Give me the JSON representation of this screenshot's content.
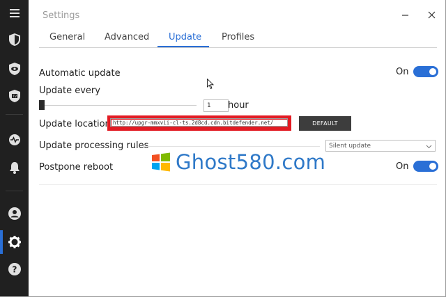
{
  "window": {
    "title": "Settings"
  },
  "tabs": [
    {
      "label": "General"
    },
    {
      "label": "Advanced"
    },
    {
      "label": "Update",
      "active": true
    },
    {
      "label": "Profiles"
    }
  ],
  "sidebar": {
    "icons": [
      "menu-icon",
      "shield-icon",
      "eye-shield-icon",
      "tv-shield-icon",
      "activity-icon",
      "bell-icon",
      "user-icon",
      "gear-icon",
      "help-icon"
    ],
    "active": "gear-icon"
  },
  "settings": {
    "automatic_update": {
      "label": "Automatic update",
      "state_text": "On",
      "on": true
    },
    "update_every": {
      "label": "Update every",
      "value": "1",
      "unit": "hour",
      "slider_level": 0.0
    },
    "update_location": {
      "label": "Update location",
      "url": "http://upgr-mmxvii-cl-ts.2d8cd.cdn.bitdefender.net/",
      "default_label": "DEFAULT"
    },
    "update_processing_rules": {
      "label": "Update processing rules",
      "selected": "Silent update"
    },
    "postpone_reboot": {
      "label": "Postpone reboot",
      "state_text": "On",
      "on": true
    }
  },
  "watermark": {
    "text": "Ghost580.com"
  },
  "colors": {
    "accent": "#2a6fd6",
    "sidebar": "#202020",
    "highlight": "#e21b23",
    "watermark": "#2f79c8"
  }
}
